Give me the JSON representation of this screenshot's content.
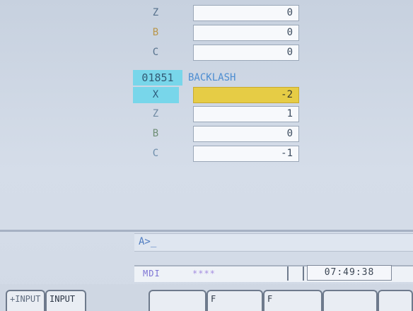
{
  "param_table": {
    "top_rows": [
      {
        "axis": "Z",
        "value": "0"
      },
      {
        "axis": "B",
        "value": "0"
      },
      {
        "axis": "C",
        "value": "0"
      }
    ],
    "param_no": "01851",
    "param_name": "BACKLASH",
    "rows": [
      {
        "axis": "X",
        "value": "-2"
      },
      {
        "axis": "Z",
        "value": "1"
      },
      {
        "axis": "B",
        "value": "0"
      },
      {
        "axis": "C",
        "value": "-1"
      }
    ]
  },
  "command_prompt": "A>_",
  "status": {
    "mode": "MDI",
    "stars": "****",
    "time": "07:49:38"
  },
  "softkeys": [
    {
      "label": "+INPUT"
    },
    {
      "label": "INPUT"
    },
    {
      "label": ""
    },
    {
      "label": "F"
    },
    {
      "label": "F"
    },
    {
      "label": ""
    },
    {
      "label": ""
    }
  ]
}
